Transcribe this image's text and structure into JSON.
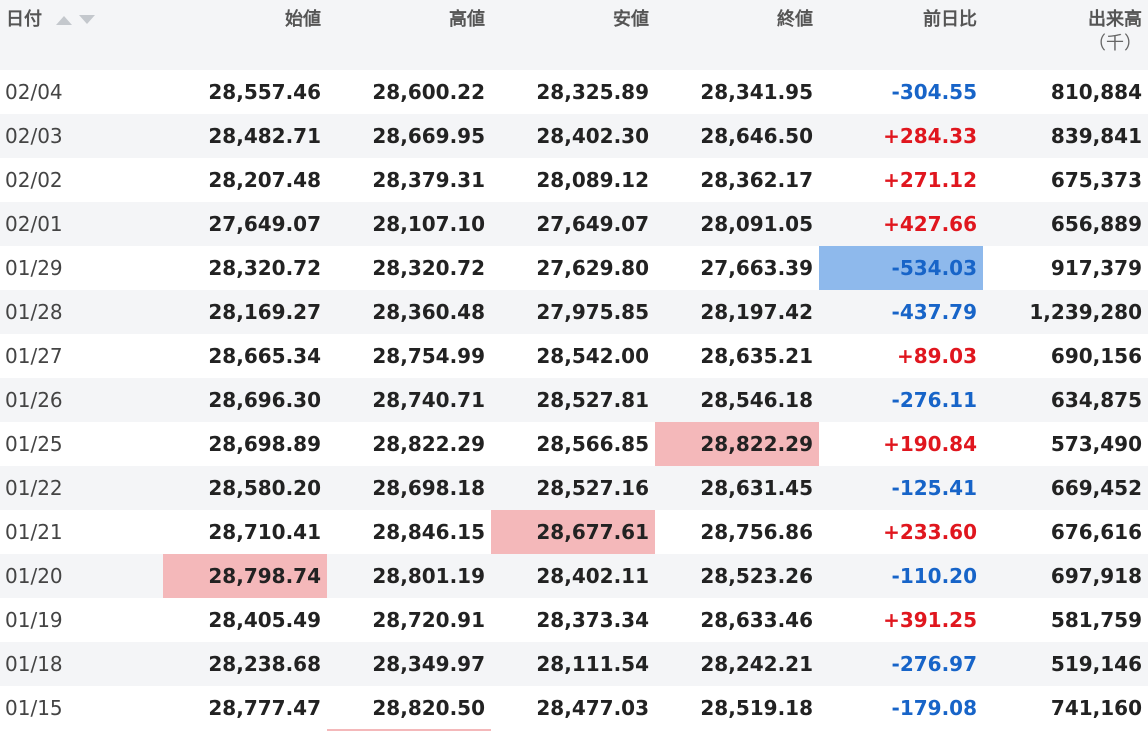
{
  "headers": {
    "date": "日付",
    "open": "始値",
    "high": "高値",
    "low": "安値",
    "close": "終値",
    "change": "前日比",
    "volume": "出来高",
    "volume_unit": "（千）"
  },
  "rows": [
    {
      "date": "02/04",
      "open": "28,557.46",
      "high": "28,600.22",
      "low": "28,325.89",
      "close": "28,341.95",
      "change": "-304.55",
      "volume": "810,884"
    },
    {
      "date": "02/03",
      "open": "28,482.71",
      "high": "28,669.95",
      "low": "28,402.30",
      "close": "28,646.50",
      "change": "+284.33",
      "volume": "839,841"
    },
    {
      "date": "02/02",
      "open": "28,207.48",
      "high": "28,379.31",
      "low": "28,089.12",
      "close": "28,362.17",
      "change": "+271.12",
      "volume": "675,373"
    },
    {
      "date": "02/01",
      "open": "27,649.07",
      "high": "28,107.10",
      "low": "27,649.07",
      "close": "28,091.05",
      "change": "+427.66",
      "volume": "656,889"
    },
    {
      "date": "01/29",
      "open": "28,320.72",
      "high": "28,320.72",
      "low": "27,629.80",
      "close": "27,663.39",
      "change": "-534.03",
      "volume": "917,379"
    },
    {
      "date": "01/28",
      "open": "28,169.27",
      "high": "28,360.48",
      "low": "27,975.85",
      "close": "28,197.42",
      "change": "-437.79",
      "volume": "1,239,280"
    },
    {
      "date": "01/27",
      "open": "28,665.34",
      "high": "28,754.99",
      "low": "28,542.00",
      "close": "28,635.21",
      "change": "+89.03",
      "volume": "690,156"
    },
    {
      "date": "01/26",
      "open": "28,696.30",
      "high": "28,740.71",
      "low": "28,527.81",
      "close": "28,546.18",
      "change": "-276.11",
      "volume": "634,875"
    },
    {
      "date": "01/25",
      "open": "28,698.89",
      "high": "28,822.29",
      "low": "28,566.85",
      "close": "28,822.29",
      "change": "+190.84",
      "volume": "573,490"
    },
    {
      "date": "01/22",
      "open": "28,580.20",
      "high": "28,698.18",
      "low": "28,527.16",
      "close": "28,631.45",
      "change": "-125.41",
      "volume": "669,452"
    },
    {
      "date": "01/21",
      "open": "28,710.41",
      "high": "28,846.15",
      "low": "28,677.61",
      "close": "28,756.86",
      "change": "+233.60",
      "volume": "676,616"
    },
    {
      "date": "01/20",
      "open": "28,798.74",
      "high": "28,801.19",
      "low": "28,402.11",
      "close": "28,523.26",
      "change": "-110.20",
      "volume": "697,918"
    },
    {
      "date": "01/19",
      "open": "28,405.49",
      "high": "28,720.91",
      "low": "28,373.34",
      "close": "28,633.46",
      "change": "+391.25",
      "volume": "581,759"
    },
    {
      "date": "01/18",
      "open": "28,238.68",
      "high": "28,349.97",
      "low": "28,111.54",
      "close": "28,242.21",
      "change": "-276.97",
      "volume": "519,146"
    },
    {
      "date": "01/15",
      "open": "28,777.47",
      "high": "28,820.50",
      "low": "28,477.03",
      "close": "28,519.18",
      "change": "-179.08",
      "volume": "741,160"
    }
  ],
  "highlights": [
    {
      "row": 4,
      "col": "change",
      "color": "#8eb9ec"
    },
    {
      "row": 8,
      "col": "close",
      "color": "#f4b8ba"
    },
    {
      "row": 10,
      "col": "low",
      "color": "#f4b8ba"
    },
    {
      "row": 11,
      "col": "open",
      "color": "#f4b8ba"
    }
  ],
  "colors": {
    "up": "#e0161e",
    "down": "#1764c8",
    "header_bg": "#f4f5f7",
    "stripe_bg": "#f4f5f7",
    "highlight_red": "#f4b8ba",
    "highlight_blue": "#8eb9ec"
  },
  "icons": {
    "sort_asc": "sort-asc-icon",
    "sort_desc": "sort-desc-icon"
  }
}
